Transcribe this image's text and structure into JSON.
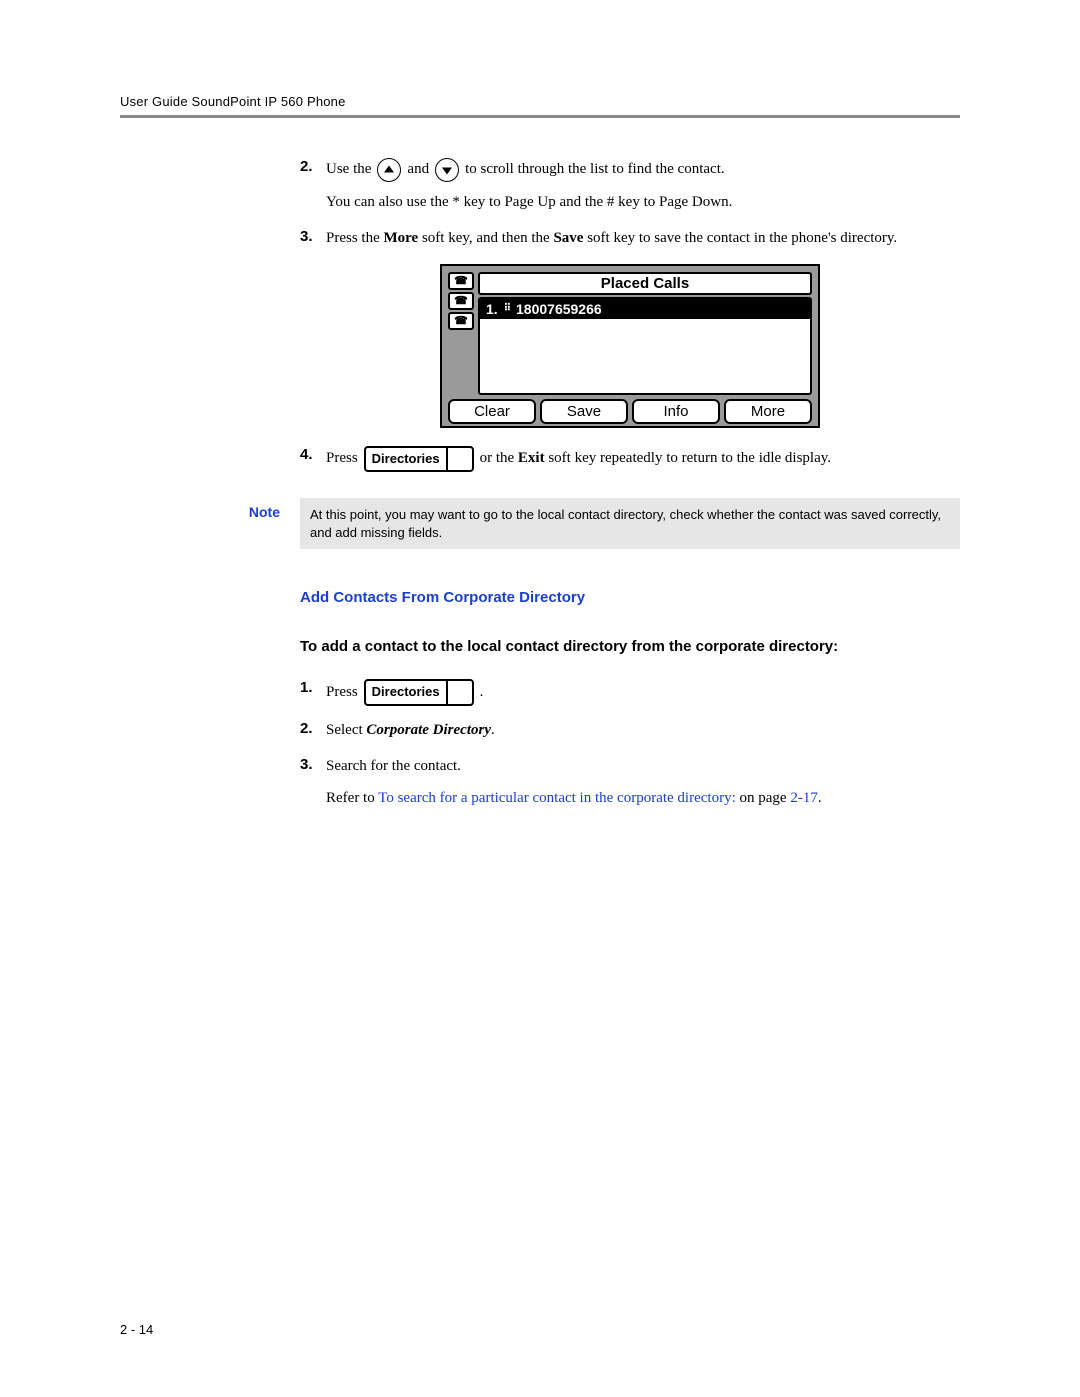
{
  "header": "User Guide SoundPoint IP 560 Phone",
  "steps_a": {
    "s2": {
      "num": "2.",
      "pre": "Use the",
      "mid": "and",
      "post": "to scroll through the list to find the contact.",
      "sub": "You can also use the * key to Page Up and the # key to Page Down."
    },
    "s3": {
      "num": "3.",
      "t1": "Press the ",
      "b1": "More",
      "t2": " soft key, and then the ",
      "b2": "Save",
      "t3": " soft key to save the contact in the phone's directory."
    },
    "s4": {
      "num": "4.",
      "pre": "Press",
      "btn": "Directories",
      "mid1": " or the ",
      "b1": "Exit",
      "mid2": " soft key repeatedly to return to the idle display."
    }
  },
  "phone": {
    "title": "Placed Calls",
    "row_prefix": "1.",
    "row_number": "18007659266",
    "softkeys": [
      "Clear",
      "Save",
      "Info",
      "More"
    ]
  },
  "note": {
    "label": "Note",
    "text": "At this point, you may want to go to the local contact directory, check whether the contact was saved correctly, and add missing fields."
  },
  "section": {
    "h3": "Add Contacts From Corporate Directory",
    "h4": "To add a contact to the local contact directory from the corporate directory:"
  },
  "steps_b": {
    "s1": {
      "num": "1.",
      "pre": "Press",
      "btn": "Directories",
      "post": "."
    },
    "s2": {
      "num": "2.",
      "t1": "Select ",
      "i1": "Corporate Directory",
      "t2": "."
    },
    "s3": {
      "num": "3.",
      "line": "Search for the contact.",
      "sub_pre": "Refer to ",
      "sub_link": "To search for a particular contact in the corporate directory:",
      "sub_mid": " on page ",
      "sub_page": "2-17",
      "sub_end": "."
    }
  },
  "pagenum": "2 - 14"
}
